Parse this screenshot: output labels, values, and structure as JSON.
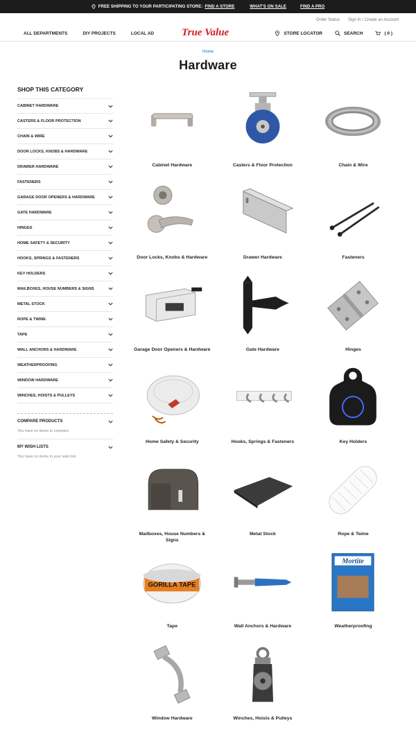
{
  "promo": {
    "text": "FREE SHIPPING TO YOUR PARTICIPATING STORE:",
    "link1": "FIND A STORE",
    "link2": "WHAT'S ON SALE",
    "link3": "FIND A PRO"
  },
  "util": {
    "order_status": "Order Status",
    "sign_in": "Sign In / Create an Account"
  },
  "nav": {
    "all_departments": "ALL DEPARTMENTS",
    "diy_projects": "DIY PROJECTS",
    "local_ad": "LOCAL AD",
    "store_locator": "STORE LOCATOR",
    "search": "SEARCH",
    "cart": "( 0 )"
  },
  "brand": {
    "logo_text": "True Value",
    "color": "#d71920"
  },
  "breadcrumb": "Home",
  "page_title": "Hardware",
  "sidebar": {
    "heading": "SHOP THIS CATEGORY",
    "items": [
      "CABINET HARDWARE",
      "CASTERS & FLOOR PROTECTION",
      "CHAIN & WIRE",
      "DOOR LOCKS, KNOBS & HARDWARE",
      "DRAWER HARDWARE",
      "FASTENERS",
      "GARAGE DOOR OPENERS & HARDWARE",
      "GATE HARDWARE",
      "HINGES",
      "HOME SAFETY & SECURITY",
      "HOOKS, SPRINGS & FASTENERS",
      "KEY HOLDERS",
      "MAILBOXES, HOUSE NUMBERS & SIGNS",
      "METAL STOCK",
      "ROPE & TWINE",
      "TAPE",
      "WALL ANCHORS & HARDWARE",
      "WEATHERPROOFING",
      "WINDOW HARDWARE",
      "WINCHES, HOISTS & PULLEYS"
    ],
    "compare_heading": "COMPARE PRODUCTS",
    "compare_note": "You have no items to compare.",
    "wishlist_heading": "MY WISH LISTS",
    "wishlist_note": "You have no items in your wish list."
  },
  "categories": [
    {
      "label": "Cabinet Hardware",
      "icon": "cabinet-pull"
    },
    {
      "label": "Casters & Floor Protection",
      "icon": "caster-wheel"
    },
    {
      "label": "Chain & Wire",
      "icon": "wire-coil"
    },
    {
      "label": "Door Locks, Knobs & Hardware",
      "icon": "door-lever-deadbolt"
    },
    {
      "label": "Drawer Hardware",
      "icon": "drawer-slide"
    },
    {
      "label": "Fasteners",
      "icon": "nails"
    },
    {
      "label": "Garage Door Openers & Hardware",
      "icon": "garage-opener"
    },
    {
      "label": "Gate Hardware",
      "icon": "gate-hinge"
    },
    {
      "label": "Hinges",
      "icon": "butt-hinge"
    },
    {
      "label": "Home Safety & Security",
      "icon": "smoke-detector"
    },
    {
      "label": "Hooks, Springs & Fasteners",
      "icon": "hook-rack"
    },
    {
      "label": "Key Holders",
      "icon": "key-lockbox"
    },
    {
      "label": "Mailboxes, House Numbers & Signs",
      "icon": "mailbox"
    },
    {
      "label": "Metal Stock",
      "icon": "metal-sheet"
    },
    {
      "label": "Rope & Twine",
      "icon": "rope-hank"
    },
    {
      "label": "Tape",
      "icon": "duct-tape-roll"
    },
    {
      "label": "Wall Anchors & Hardware",
      "icon": "wall-anchor"
    },
    {
      "label": "Weatherproofing",
      "icon": "mortite-box"
    },
    {
      "label": "Window Hardware",
      "icon": "window-pull"
    },
    {
      "label": "Winches, Hoists & Pulleys",
      "icon": "pulley"
    }
  ],
  "product_text": {
    "tape_brand": "GORILLA TAPE",
    "mortite_brand": "Mortite"
  }
}
